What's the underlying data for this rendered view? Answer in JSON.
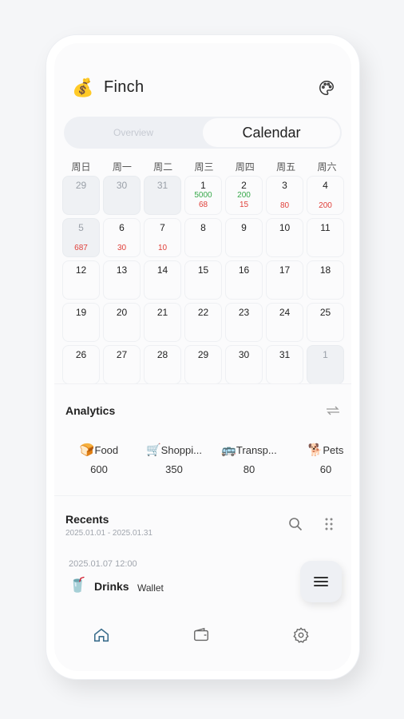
{
  "app": {
    "title": "Finch",
    "logo_icon": "money-bag-icon"
  },
  "tabs": {
    "overview": "Overview",
    "calendar": "Calendar",
    "active": "calendar"
  },
  "calendar": {
    "weekdays": [
      "周日",
      "周一",
      "周二",
      "周三",
      "周四",
      "周五",
      "周六"
    ],
    "days": [
      {
        "day": "29",
        "muted": true,
        "income": "",
        "expense": ""
      },
      {
        "day": "30",
        "muted": true,
        "income": "",
        "expense": ""
      },
      {
        "day": "31",
        "muted": true,
        "income": "",
        "expense": ""
      },
      {
        "day": "1",
        "muted": false,
        "income": "5000",
        "expense": "68"
      },
      {
        "day": "2",
        "muted": false,
        "income": "200",
        "expense": "15"
      },
      {
        "day": "3",
        "muted": false,
        "income": "",
        "expense": "80"
      },
      {
        "day": "4",
        "muted": false,
        "income": "",
        "expense": "200"
      },
      {
        "day": "5",
        "muted": true,
        "income": "",
        "expense": "687"
      },
      {
        "day": "6",
        "muted": false,
        "income": "",
        "expense": "30"
      },
      {
        "day": "7",
        "muted": false,
        "income": "",
        "expense": "10"
      },
      {
        "day": "8",
        "muted": false,
        "income": "",
        "expense": ""
      },
      {
        "day": "9",
        "muted": false,
        "income": "",
        "expense": ""
      },
      {
        "day": "10",
        "muted": false,
        "income": "",
        "expense": ""
      },
      {
        "day": "11",
        "muted": false,
        "income": "",
        "expense": ""
      },
      {
        "day": "12",
        "muted": false,
        "income": "",
        "expense": ""
      },
      {
        "day": "13",
        "muted": false,
        "income": "",
        "expense": ""
      },
      {
        "day": "14",
        "muted": false,
        "income": "",
        "expense": ""
      },
      {
        "day": "15",
        "muted": false,
        "income": "",
        "expense": ""
      },
      {
        "day": "16",
        "muted": false,
        "income": "",
        "expense": ""
      },
      {
        "day": "17",
        "muted": false,
        "income": "",
        "expense": ""
      },
      {
        "day": "18",
        "muted": false,
        "income": "",
        "expense": ""
      },
      {
        "day": "19",
        "muted": false,
        "income": "",
        "expense": ""
      },
      {
        "day": "20",
        "muted": false,
        "income": "",
        "expense": ""
      },
      {
        "day": "21",
        "muted": false,
        "income": "",
        "expense": ""
      },
      {
        "day": "22",
        "muted": false,
        "income": "",
        "expense": ""
      },
      {
        "day": "23",
        "muted": false,
        "income": "",
        "expense": ""
      },
      {
        "day": "24",
        "muted": false,
        "income": "",
        "expense": ""
      },
      {
        "day": "25",
        "muted": false,
        "income": "",
        "expense": ""
      },
      {
        "day": "26",
        "muted": false,
        "income": "",
        "expense": ""
      },
      {
        "day": "27",
        "muted": false,
        "income": "",
        "expense": ""
      },
      {
        "day": "28",
        "muted": false,
        "income": "",
        "expense": ""
      },
      {
        "day": "29",
        "muted": false,
        "income": "",
        "expense": ""
      },
      {
        "day": "30",
        "muted": false,
        "income": "",
        "expense": ""
      },
      {
        "day": "31",
        "muted": false,
        "income": "",
        "expense": ""
      },
      {
        "day": "1",
        "muted": true,
        "income": "",
        "expense": ""
      }
    ],
    "income_color": "#37a84a",
    "expense_color": "#e0403a"
  },
  "analytics": {
    "title": "Analytics",
    "categories": [
      {
        "icon": "🍞",
        "label": "Food",
        "value": "600"
      },
      {
        "icon": "🛒",
        "label": "Shoppi...",
        "value": "350"
      },
      {
        "icon": "🚌",
        "label": "Transp...",
        "value": "80"
      },
      {
        "icon": "🐕",
        "label": "Pets",
        "value": "60"
      }
    ]
  },
  "recents": {
    "title": "Recents",
    "range": "2025.01.01 - 2025.01.31",
    "transactions": [
      {
        "date": "2025.01.07 12:00",
        "icon": "🥤",
        "name": "Drinks",
        "account": "Wallet"
      }
    ]
  },
  "nav": {
    "items": [
      "home-icon",
      "wallet-icon",
      "settings-icon"
    ],
    "active": "home-icon",
    "active_color": "#3a6d8c"
  }
}
